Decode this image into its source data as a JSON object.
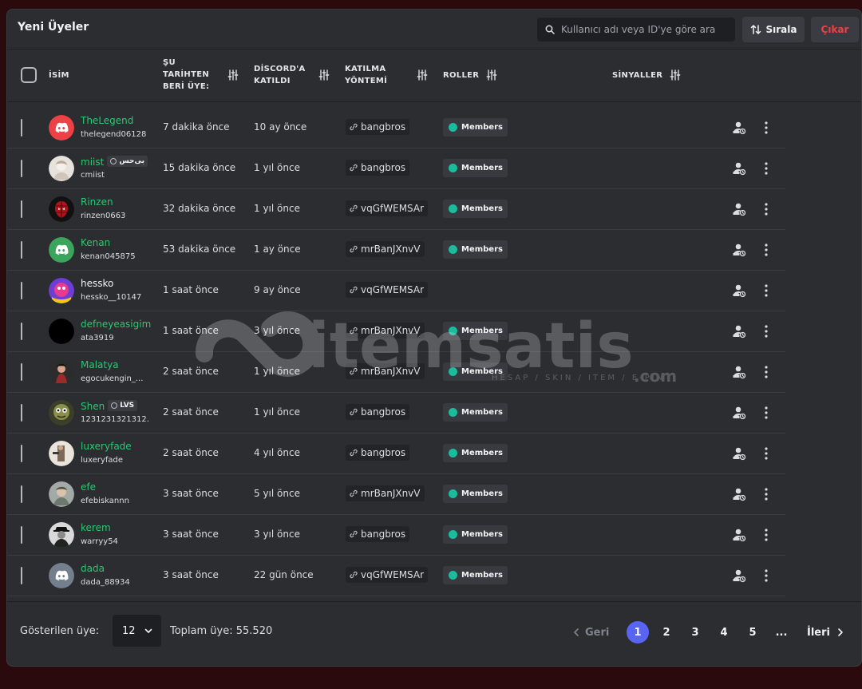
{
  "title": "Yeni Üyeler",
  "search": {
    "placeholder": "Kullanıcı adı veya ID'ye göre ara"
  },
  "sort_label": "Sırala",
  "exit_label": "Çıkar",
  "columns": {
    "name": "İSİM",
    "member_since": [
      "ŞU",
      "TARİHTEN",
      "BERİ ÜYE:"
    ],
    "discord_joined": [
      "DİSCORD'A",
      "KATILDI"
    ],
    "join_method": [
      "KATILMA",
      "YÖNTEMİ"
    ],
    "roles": "ROLLER",
    "signals": "SİNYALLER"
  },
  "role_label": "Members",
  "colors": {
    "accent": "#5865f2",
    "name_green": "#2dc770",
    "role_dot": "#1abc9c",
    "danger": "#f23f43"
  },
  "members": [
    {
      "name": "TheLegend",
      "handle": "thelegend06128",
      "member_since": "7 dakika önce",
      "discord_joined": "10 ay önce",
      "invite": "bangbros",
      "has_role": true,
      "avatar": "discord-blurple-red",
      "tag": ""
    },
    {
      "name": "miist",
      "handle": "cmiist",
      "member_since": "15 dakika önce",
      "discord_joined": "1 yıl önce",
      "invite": "bangbros",
      "has_role": true,
      "avatar": "photo-light",
      "tag": "بی‌حس"
    },
    {
      "name": "Rinzen",
      "handle": "rinzen0663",
      "member_since": "32 dakika önce",
      "discord_joined": "1 yıl önce",
      "invite": "vqGfWEMSAr",
      "has_role": true,
      "avatar": "photo-spider",
      "tag": ""
    },
    {
      "name": "Kenan",
      "handle": "kenan045875",
      "member_since": "53 dakika önce",
      "discord_joined": "1 ay önce",
      "invite": "mrBanJXnvV",
      "has_role": true,
      "avatar": "discord-green",
      "tag": ""
    },
    {
      "name": "hessko",
      "handle": "hessko__10147",
      "member_since": "1 saat önce",
      "discord_joined": "9 ay önce",
      "invite": "vqGfWEMSAr",
      "has_role": false,
      "avatar": "photo-pink",
      "tag": ""
    },
    {
      "name": "defneyeasigim",
      "handle": "ata3919",
      "member_since": "1 saat önce",
      "discord_joined": "3 yıl önce",
      "invite": "mrBanJXnvV",
      "has_role": true,
      "avatar": "photo-black",
      "tag": ""
    },
    {
      "name": "Malatya",
      "handle": "egocukengin_...",
      "member_since": "2 saat önce",
      "discord_joined": "1 yıl önce",
      "invite": "mrBanJXnvV",
      "has_role": true,
      "avatar": "photo-dark",
      "tag": ""
    },
    {
      "name": "Shen",
      "handle": "1231231321312...",
      "member_since": "2 saat önce",
      "discord_joined": "1 yıl önce",
      "invite": "bangbros",
      "has_role": true,
      "avatar": "photo-green",
      "tag": "LVS"
    },
    {
      "name": "luxeryfade",
      "handle": "luxeryfade",
      "member_since": "2 saat önce",
      "discord_joined": "4 yıl önce",
      "invite": "bangbros",
      "has_role": true,
      "avatar": "photo-beige",
      "tag": ""
    },
    {
      "name": "efe",
      "handle": "efebiskannn",
      "member_since": "3 saat önce",
      "discord_joined": "5 yıl önce",
      "invite": "mrBanJXnvV",
      "has_role": true,
      "avatar": "photo-gray",
      "tag": ""
    },
    {
      "name": "kerem",
      "handle": "warryy54",
      "member_since": "3 saat önce",
      "discord_joined": "3 yıl önce",
      "invite": "bangbros",
      "has_role": true,
      "avatar": "photo-bw",
      "tag": ""
    },
    {
      "name": "dada",
      "handle": "dada_88934",
      "member_since": "3 saat önce",
      "discord_joined": "22 gün önce",
      "invite": "vqGfWEMSAr",
      "has_role": true,
      "avatar": "discord-gray",
      "tag": ""
    }
  ],
  "footer": {
    "shown_label": "Gösterilen üye:",
    "shown_value": "12",
    "total_label": "Toplam üye: 55.520",
    "prev_label": "Geri",
    "next_label": "İleri",
    "pages": [
      "1",
      "2",
      "3",
      "4",
      "5",
      "..."
    ],
    "current_page": "1"
  },
  "watermark": {
    "brand": "itemsatis",
    "tagline": "HESAP / SKIN / ITEM / E-PIN",
    "suffix": ".com"
  }
}
